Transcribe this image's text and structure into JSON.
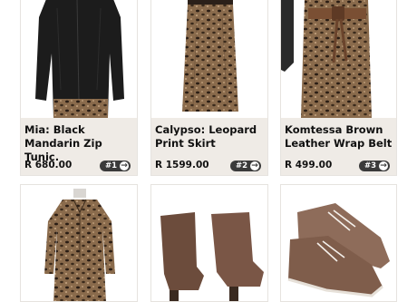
{
  "products": [
    {
      "title": "Mia: Black Mandarin Zip Tunic.",
      "price": "R 680.00",
      "rank": "#1",
      "image": "black-tunic"
    },
    {
      "title": "Calypso: Leopard Print Skirt",
      "price": "R 1599.00",
      "rank": "#2",
      "image": "leopard-skirt"
    },
    {
      "title": "Komtessa Brown Leather Wrap Belt",
      "price": "R 499.00",
      "rank": "#3",
      "image": "brown-belt"
    },
    {
      "title": "",
      "price": "",
      "rank": "",
      "image": "leopard-shirt-dress"
    },
    {
      "title": "",
      "price": "",
      "rank": "",
      "image": "brown-ankle-boots"
    },
    {
      "title": "",
      "price": "",
      "rank": "",
      "image": "brown-sneakers"
    }
  ],
  "colors": {
    "info_bg": "#efebe6",
    "badge_bg": "#3a3a3a",
    "card_border": "#e6e3df"
  },
  "icons": {
    "badge_arrow": "arrow-right-circle-icon"
  }
}
